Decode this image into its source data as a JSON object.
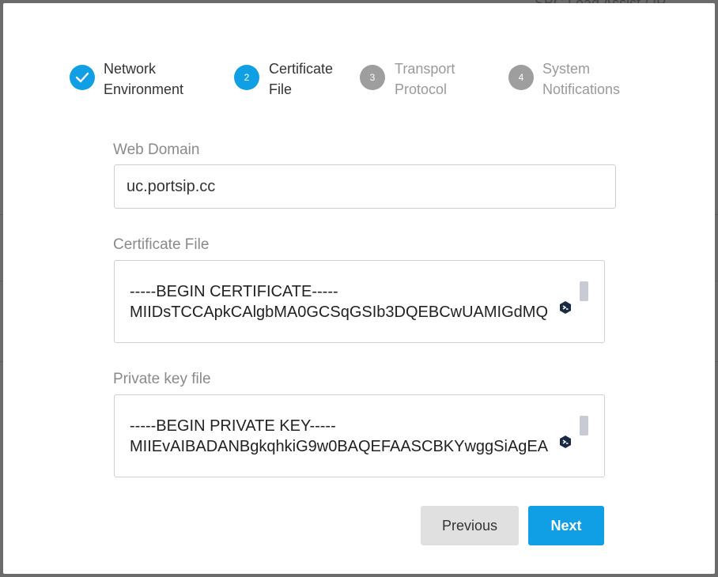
{
  "backdrop": {
    "text": "SBC Load Assist / IP"
  },
  "stepper": {
    "steps": [
      {
        "number": "",
        "label": "Network\nEnvironment",
        "state": "done"
      },
      {
        "number": "2",
        "label": "Certificate\nFile",
        "state": "current"
      },
      {
        "number": "3",
        "label": "Transport\nProtocol",
        "state": "pending"
      },
      {
        "number": "4",
        "label": "System\nNotifications",
        "state": "pending"
      }
    ]
  },
  "form": {
    "web_domain": {
      "label": "Web Domain",
      "value": "uc.portsip.cc"
    },
    "certificate_file": {
      "label": "Certificate File",
      "value": "-----BEGIN CERTIFICATE-----\nMIIDsTCCApkCAlgbMA0GCSqGSIb3DQEBCwUAMIGdMQ"
    },
    "private_key_file": {
      "label": "Private key file",
      "value": "-----BEGIN PRIVATE KEY-----\nMIIEvAIBADANBgkqhkiG9w0BAQEFAASCBKYwggSiAgEA"
    }
  },
  "buttons": {
    "previous": "Previous",
    "next": "Next"
  },
  "colors": {
    "accent": "#109ee4",
    "inactive_step": "#9e9e9e",
    "backdrop": "#6b6b6b"
  }
}
